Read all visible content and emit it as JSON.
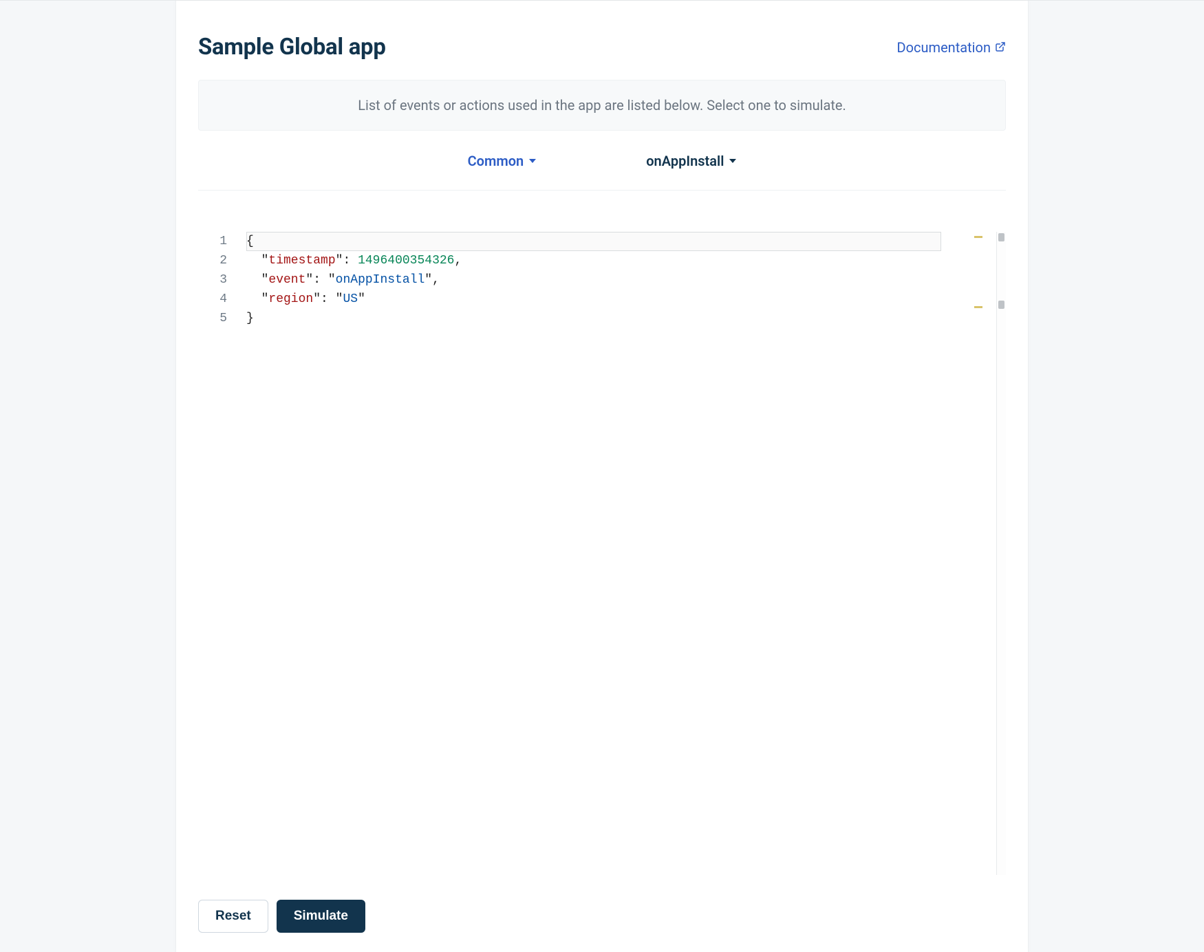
{
  "header": {
    "title": "Sample Global app",
    "doc_link_label": "Documentation"
  },
  "info": {
    "message": "List of events or actions used in the app are listed below. Select one to simulate."
  },
  "dropdowns": {
    "category": "Common",
    "event": "onAppInstall"
  },
  "editor": {
    "line_numbers": [
      "1",
      "2",
      "3",
      "4",
      "5"
    ],
    "json": {
      "timestamp": 1496400354326,
      "event": "onAppInstall",
      "region": "US"
    },
    "tokens": {
      "brace_open": "{",
      "brace_close": "}",
      "colon": ":",
      "comma": ",",
      "q": "\"",
      "keys": {
        "timestamp": "timestamp",
        "event": "event",
        "region": "region"
      },
      "vals": {
        "timestamp": "1496400354326",
        "event": "onAppInstall",
        "region": "US"
      }
    }
  },
  "footer": {
    "reset_label": "Reset",
    "simulate_label": "Simulate"
  }
}
